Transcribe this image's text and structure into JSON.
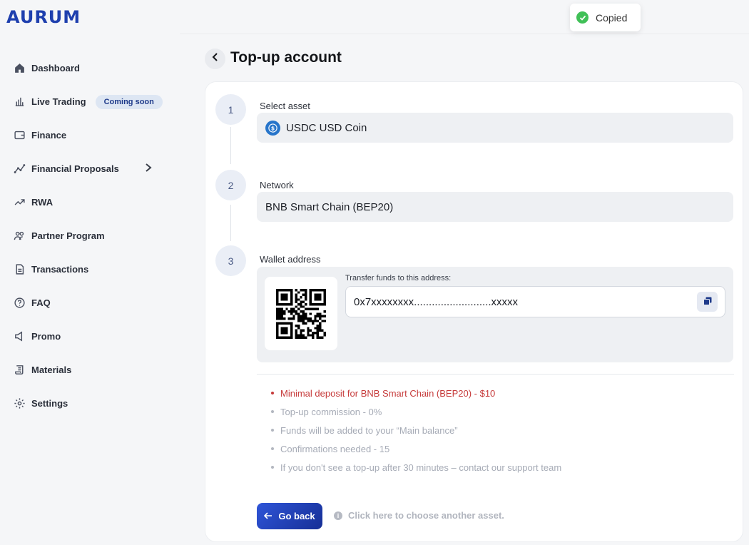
{
  "app": {
    "logo": "AURUM"
  },
  "sidebar": {
    "items": [
      {
        "label": "Dashboard",
        "icon": "home-icon"
      },
      {
        "label": "Live Trading",
        "icon": "bar-chart-icon",
        "badge": "Coming soon"
      },
      {
        "label": "Finance",
        "icon": "wallet-icon"
      },
      {
        "label": "Financial Proposals",
        "icon": "line-chart-icon"
      },
      {
        "label": "RWA",
        "icon": "trending-up-icon"
      },
      {
        "label": "Partner Program",
        "icon": "users-icon"
      },
      {
        "label": "Transactions",
        "icon": "document-icon"
      },
      {
        "label": "FAQ",
        "icon": "help-circle-icon"
      },
      {
        "label": "Promo",
        "icon": "megaphone-icon"
      },
      {
        "label": "Materials",
        "icon": "scroll-icon"
      },
      {
        "label": "Settings",
        "icon": "gear-icon"
      }
    ]
  },
  "toast": {
    "text": "Copied",
    "color": "#40c057"
  },
  "page": {
    "title": "Top-up account"
  },
  "steps": [
    {
      "number": "1",
      "label": "Select asset",
      "value": "USDC USD Coin"
    },
    {
      "number": "2",
      "label": "Network",
      "value": "BNB Smart Chain (BEP20)"
    },
    {
      "number": "3",
      "label": "Wallet address"
    }
  ],
  "wallet": {
    "transfer_label": "Transfer funds to this address:",
    "address": "0x7xxxxxxxx..........................xxxxx"
  },
  "notes": [
    "Minimal deposit for BNB Smart Chain (BEP20) - $10",
    "Top-up commission - 0%",
    "Funds will be added to your “Main balance”",
    "Confirmations needed - 15",
    "If you don't see a top-up after 30 minutes – contact our support team"
  ],
  "actions": {
    "go_back": "Go back",
    "hint": "Click here to choose another asset."
  },
  "colors": {
    "brand": "#1e3fae",
    "accent": "#2f55d8",
    "warning": "#c63b3b"
  }
}
